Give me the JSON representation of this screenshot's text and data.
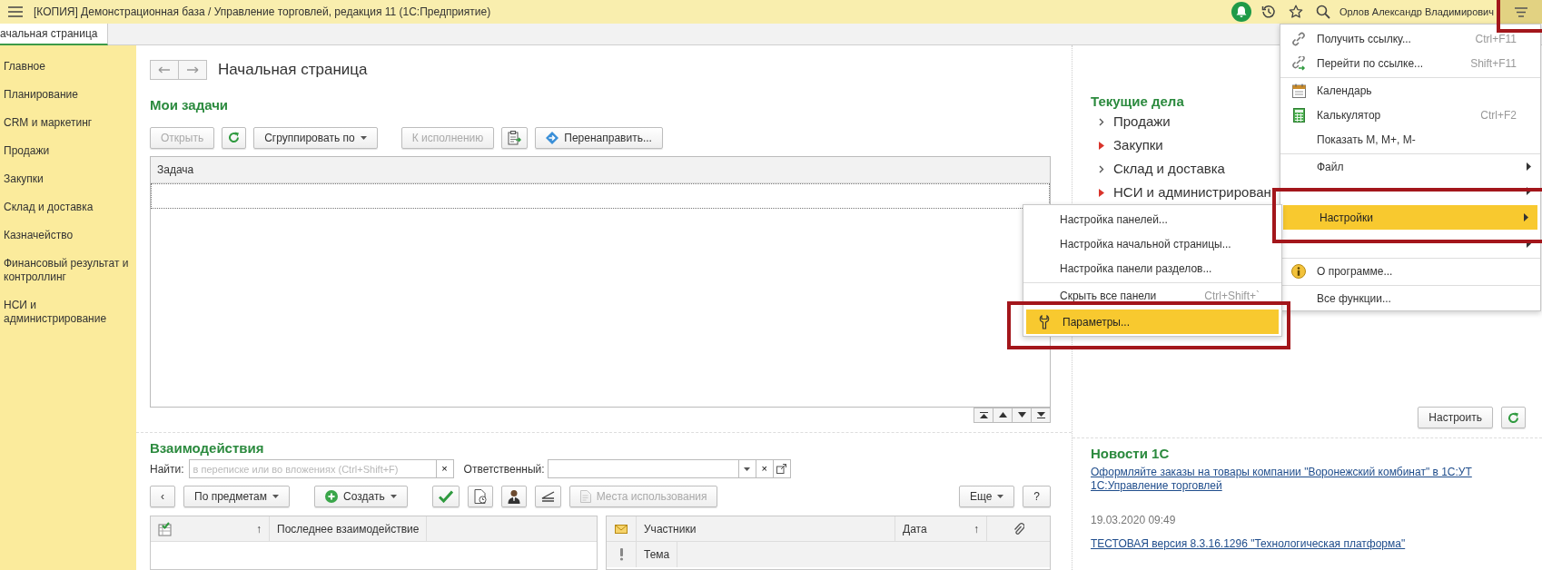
{
  "window": {
    "title": "[КОПИЯ] Демонстрационная база / Управление торговлей, редакция 11  (1С:Предприятие)",
    "user": "Орлов Александр Владимирович"
  },
  "tabs": [
    {
      "label": "ачальная страница",
      "selected": true
    }
  ],
  "sidebar": {
    "items": [
      {
        "label": "Главное"
      },
      {
        "label": "Планирование"
      },
      {
        "label": "CRM и маркетинг"
      },
      {
        "label": "Продажи"
      },
      {
        "label": "Закупки"
      },
      {
        "label": "Склад и доставка"
      },
      {
        "label": "Казначейство"
      },
      {
        "label": "Финансовый результат и контроллинг"
      },
      {
        "label": "НСИ и администрирование"
      }
    ]
  },
  "page": {
    "title": "Начальная страница"
  },
  "my_tasks": {
    "title": "Мои задачи",
    "toolbar": [
      {
        "kind": "text",
        "label": "Открыть",
        "disabled": true
      },
      {
        "kind": "icon",
        "disabled": false
      },
      {
        "kind": "dropdown",
        "label": "Сгруппировать по",
        "disabled": false
      },
      {
        "kind": "text",
        "label": "К исполнению",
        "disabled": true
      },
      {
        "kind": "icon",
        "disabled": false
      },
      {
        "kind": "icon-text",
        "label": "Перенаправить...",
        "disabled": false
      }
    ],
    "table": {
      "columns": [
        {
          "label": "Задача"
        }
      ]
    }
  },
  "interactions": {
    "title": "Взаимодействия",
    "find_label": "Найти:",
    "find_placeholder": "в переписке или во вложениях (Ctrl+Shift+F)",
    "find_clear": "×",
    "responsible_label": "Ответственный:",
    "responsible_clear": "×",
    "toolbar": [
      {
        "kind": "text",
        "label": "‹",
        "disabled": false
      },
      {
        "kind": "dropdown",
        "label": "По предметам",
        "disabled": false
      },
      {
        "kind": "icon-dropdown",
        "label": "Создать",
        "disabled": false
      },
      {
        "kind": "icon",
        "disabled": false
      },
      {
        "kind": "icon",
        "disabled": false
      },
      {
        "kind": "icon",
        "disabled": false
      },
      {
        "kind": "icon",
        "disabled": false
      },
      {
        "kind": "icon-text",
        "label": "Места использования",
        "disabled": true
      }
    ],
    "more_button": "Еще",
    "help_button": "?",
    "subjects_table": {
      "sort_mark": "↑",
      "columns": [
        {
          "label": "Последнее взаимодействие"
        }
      ]
    },
    "list_table": {
      "columns": [
        {
          "label": "Участники"
        },
        {
          "label": "Дата",
          "sort_mark": "↑"
        }
      ],
      "subrow": "Тема"
    }
  },
  "current_affairs": {
    "title": "Текущие дела",
    "items": [
      {
        "label": "Продажи",
        "alert": false
      },
      {
        "label": "Закупки",
        "alert": true
      },
      {
        "label": "Склад и доставка",
        "alert": false
      },
      {
        "label": "НСИ и администрирован",
        "alert": true
      }
    ],
    "setup_button": "Настроить"
  },
  "news": {
    "title": "Новости 1С",
    "items": [
      {
        "kind": "link",
        "text": "Оформляйте заказы на товары компании \"Воронежский комбинат\" в 1С:УТ"
      },
      {
        "kind": "link",
        "text": "1С:Управление торговлей"
      },
      {
        "kind": "date",
        "text": "19.03.2020 09:49"
      },
      {
        "kind": "link",
        "text": "ТЕСТОВАЯ версия 8.3.16.1296 \"Технологическая платформа\""
      }
    ]
  },
  "main_menu": {
    "items": [
      {
        "kind": "item",
        "label": "Получить ссылку...",
        "shortcut": "Ctrl+F11",
        "has_submenu": false,
        "selected": false
      },
      {
        "kind": "item",
        "label": "Перейти по ссылке...",
        "shortcut": "Shift+F11",
        "has_submenu": false,
        "selected": false
      },
      {
        "kind": "separator"
      },
      {
        "kind": "item",
        "label": "Календарь",
        "has_submenu": false,
        "selected": false
      },
      {
        "kind": "item",
        "label": "Калькулятор",
        "shortcut": "Ctrl+F2",
        "has_submenu": false,
        "selected": false
      },
      {
        "kind": "item",
        "label": "Показать М, М+, М-",
        "has_submenu": false,
        "selected": false
      },
      {
        "kind": "separator"
      },
      {
        "kind": "item",
        "label": "Файл",
        "has_submenu": true,
        "selected": false
      },
      {
        "kind": "item",
        "has_submenu": true,
        "selected": false
      },
      {
        "kind": "item",
        "label": "Настройки",
        "has_submenu": true,
        "selected": true
      },
      {
        "kind": "item",
        "has_submenu": true,
        "selected": false
      },
      {
        "kind": "separator"
      },
      {
        "kind": "item",
        "label": "О программе...",
        "has_submenu": false,
        "selected": false
      },
      {
        "kind": "separator"
      },
      {
        "kind": "item",
        "label": "Все функции...",
        "has_submenu": false,
        "selected": false
      }
    ]
  },
  "settings_submenu": {
    "items": [
      {
        "kind": "item",
        "label": "Настройка панелей...",
        "selected": false
      },
      {
        "kind": "item",
        "label": "Настройка начальной страницы...",
        "selected": false
      },
      {
        "kind": "item",
        "label": "Настройка панели разделов...",
        "selected": false
      },
      {
        "kind": "separator"
      },
      {
        "kind": "item",
        "label": "Скрыть все панели",
        "shortcut": "Ctrl+Shift+`",
        "selected": false
      },
      {
        "kind": "item",
        "label": "Параметры...",
        "selected": true
      }
    ]
  }
}
